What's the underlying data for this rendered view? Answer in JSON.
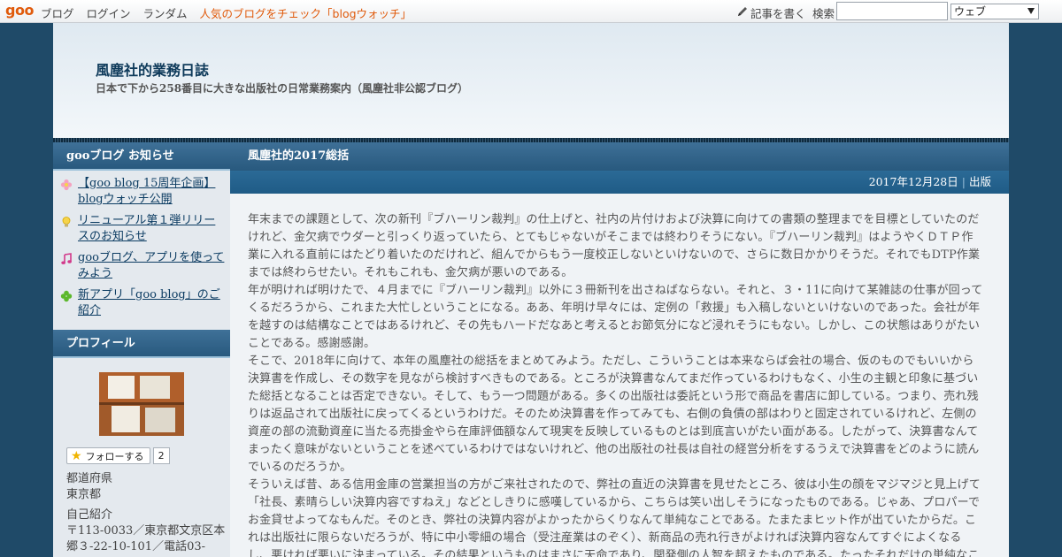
{
  "topbar": {
    "logo": "goo",
    "nav": [
      "ブログ",
      "ログイン",
      "ランダム"
    ],
    "promo": "人気のブログをチェック「blogウォッチ」",
    "write_label": "記事を書く",
    "search_label": "検索",
    "search_value": "",
    "scope_selected": "ウェブ"
  },
  "header": {
    "title": "風塵社的業務日誌",
    "description": "日本で下から258番目に大きな出版社の日常業務案内（風塵社非公認ブログ）"
  },
  "sidebar": {
    "notices_heading": "gooブログ お知らせ",
    "notices": [
      {
        "label": "【goo blog 15周年企画】blogウォッチ公開",
        "icon": "flower-icon"
      },
      {
        "label": "リニューアル第１弾リリースのお知らせ",
        "icon": "lightbulb-icon"
      },
      {
        "label": "gooブログ、アプリを使ってみよう",
        "icon": "music-note-icon"
      },
      {
        "label": "新アプリ「goo blog」のご紹介",
        "icon": "clover-icon"
      }
    ],
    "profile_heading": "プロフィール",
    "follow_label": "フォローする",
    "follow_count": "2",
    "prefecture_label": "都道府県",
    "prefecture_value": "東京都",
    "intro_label": "自己紹介",
    "intro_line1": "〒113-0033／東京都文京区本",
    "intro_line2": "郷３-22-10-101／電話03-"
  },
  "post": {
    "title": "風塵社的2017総括",
    "date": "2017年12月28日",
    "category": "出版",
    "paragraphs": [
      "年末までの課題として、次の新刊『ブハーリン裁判』の仕上げと、社内の片付けおよび決算に向けての書類の整理までを目標としていたのだけれど、金欠病でウダーと引っくり返っていたら、とてもじゃないがそこまでは終わりそうにない。『ブハーリン裁判』はようやくＤＴＰ作業に入れる直前にはたどり着いたのだけれど、組んでからもう一度校正しないといけないので、さらに数日かかりそうだ。それでもDTP作業までは終わらせたい。それもこれも、金欠病が悪いのである。",
      "年が明ければ明けたで、４月までに『ブハーリン裁判』以外に３冊新刊を出さねばならない。それと、３・11に向けて某雑誌の仕事が回ってくるだろうから、これまた大忙しということになる。ああ、年明け早々には、定例の「救援」も入稿しないといけないのであった。会社が年を越すのは結構なことではあるけれど、その先もハードだなあと考えるとお節気分になど浸れそうにもない。しかし、この状態はありがたいことである。感謝感謝。",
      "そこで、2018年に向けて、本年の風塵社の総括をまとめてみよう。ただし、こういうことは本来ならば会社の場合、仮のものでもいいから決算書を作成し、その数字を見ながら検討すべきものである。ところが決算書なんてまだ作っているわけもなく、小生の主観と印象に基づいた総括となることは否定できない。そして、もう一つ問題がある。多くの出版社は委託という形で商品を書店に卸している。つまり、売れ残りは返品されて出版社に戻ってくるというわけだ。そのため決算書を作ってみても、右側の負債の部はわりと固定されているけれど、左側の資産の部の流動資産に当たる売掛金やら在庫評価額なんて現実を反映しているものとは到底言いがたい面がある。したがって、決算書なんてまったく意味がないということを述べているわけではないけれど、他の出版社の社長は自社の経営分析をするうえで決算書をどのように読んでいるのだろうか。",
      "そういえば昔、ある信用金庫の営業担当の方がご来社されたので、弊社の直近の決算書を見せたところ、彼は小生の顔をマジマジと見上げて「社長、素晴らしい決算内容ですねえ」などとしきりに感嘆しているから、こちらは笑い出しそうになったものである。じゃあ、プロパーでお金貸せよってなもんだ。そのとき、弊社の決算内容がよかったからくりなんて単純なことである。たまたまヒット作が出ていたからだ。これは出版社に限らないだろうが、特に中小零細の場合（受注産業はのぞく）、新商品の売れ行きがよければ決算内容なんてすぐによくなるし、悪ければ悪いに決まっている。その結果というものはまさに天命であり、関発側の人智を超えたものである。たったそれだけの単純なことが、金融"
    ]
  }
}
